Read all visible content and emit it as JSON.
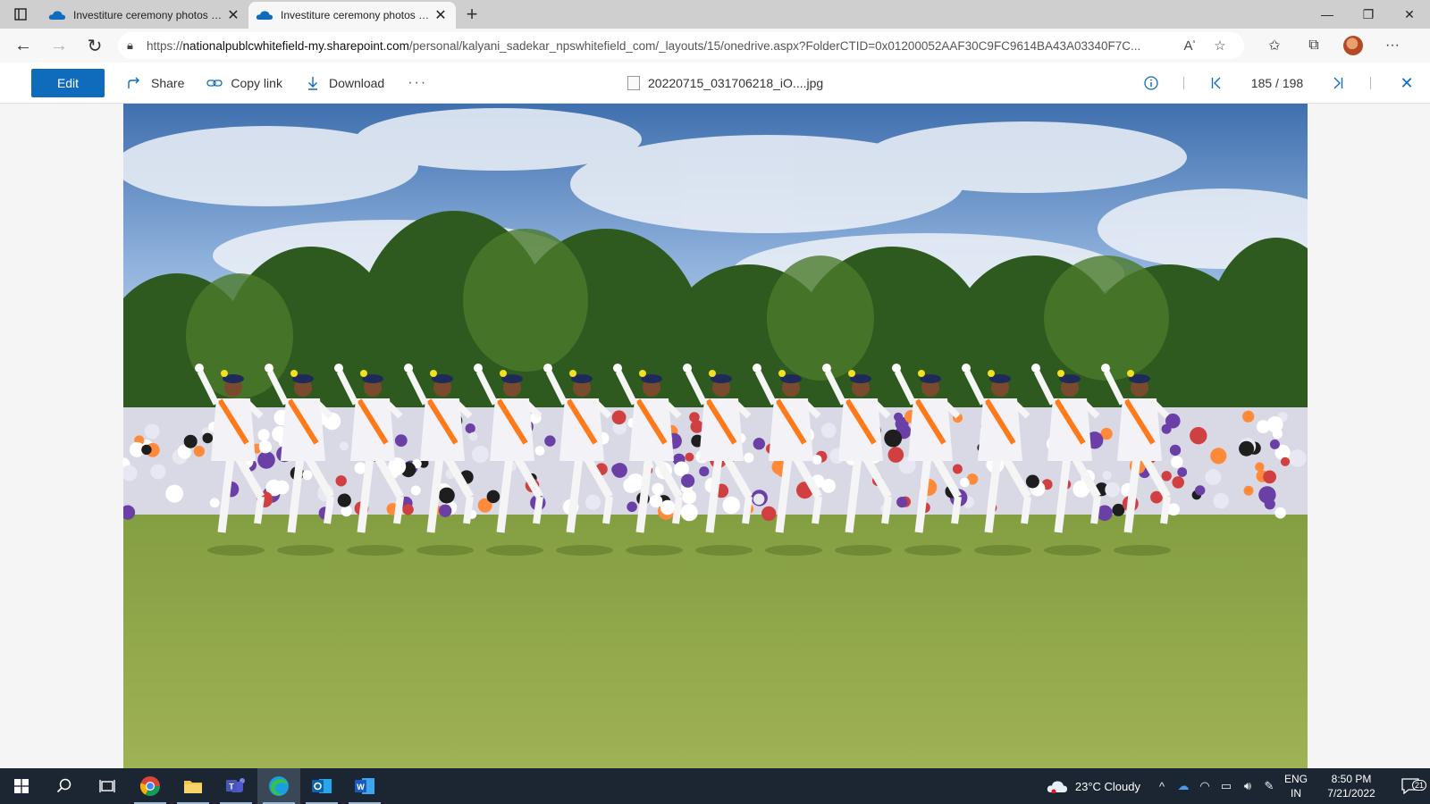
{
  "browser": {
    "tabs": [
      {
        "title": "Investiture ceremony photos - O",
        "active": false
      },
      {
        "title": "Investiture ceremony photos - O",
        "active": true
      }
    ],
    "url_prefix": "https://",
    "url_host": "nationalpublcwhitefield-my.sharepoint.com",
    "url_path": "/personal/kalyani_sadekar_npswhitefield_com/_layouts/15/onedrive.aspx?FolderCTID=0x01200052AAF30C9FC9614BA43A03340F7C..."
  },
  "commandbar": {
    "edit_label": "Edit",
    "share_label": "Share",
    "copy_link_label": "Copy link",
    "download_label": "Download",
    "more_label": "···",
    "file_name": "20220715_031706218_iO....jpg",
    "page_counter": "185 / 198"
  },
  "photo": {
    "description_icon": "image-photo",
    "accent": "#ff7a1a"
  },
  "taskbar": {
    "weather": "23°C  Cloudy",
    "lang_top": "ENG",
    "lang_bottom": "IN",
    "time": "8:50 PM",
    "date": "7/21/2022",
    "notif_count": "21"
  },
  "colors": {
    "brand_blue": "#0f6cbd",
    "taskbar": "#1c2633"
  }
}
